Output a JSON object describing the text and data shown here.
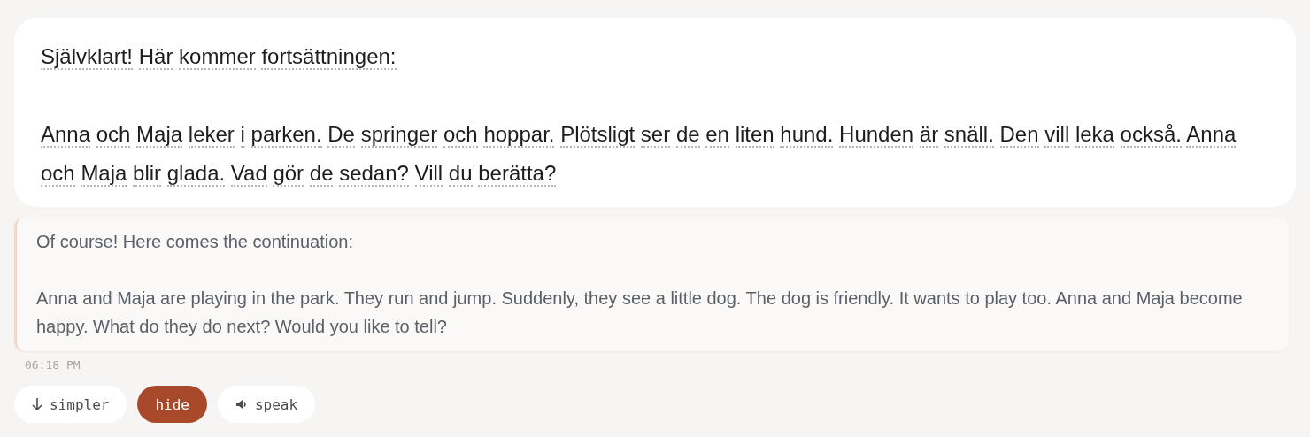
{
  "message": {
    "paragraphs": [
      "Självklart! Här kommer fortsättningen:",
      "Anna och Maja leker i parken. De springer och hoppar. Plötsligt ser de en liten hund. Hunden är snäll. Den vill leka också. Anna och Maja blir glada. Vad gör de sedan? Vill du berätta?"
    ]
  },
  "translation": {
    "paragraphs": [
      "Of course! Here comes the continuation:",
      "Anna and Maja are playing in the park. They run and jump. Suddenly, they see a little dog. The dog is friendly. It wants to play too. Anna and Maja become happy. What do they do next? Would you like to tell?"
    ]
  },
  "time": "06:18 PM",
  "actions": [
    {
      "kind": "down",
      "label": "simpler",
      "selected": false
    },
    {
      "kind": "plain",
      "label": "hide",
      "selected": true
    },
    {
      "kind": "speaker",
      "label": "speak",
      "selected": false
    }
  ]
}
